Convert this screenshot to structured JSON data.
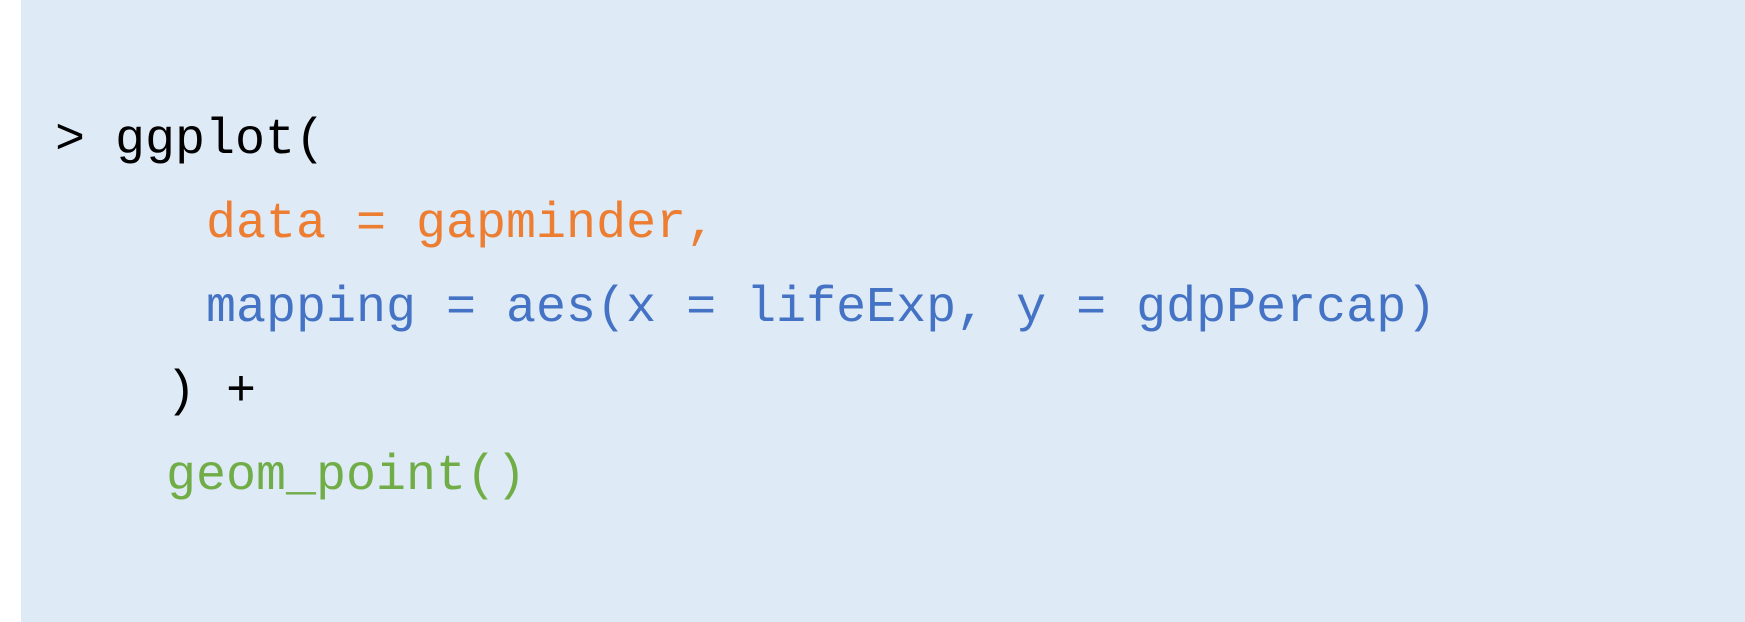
{
  "colors": {
    "background": "#deeaf6",
    "default_text": "#000000",
    "data_arg": "#ed7d31",
    "mapping_arg": "#4472c4",
    "geom": "#70ad47"
  },
  "code": {
    "lines": [
      {
        "text": "> ggplot("
      },
      {
        "text": "data = gapminder,"
      },
      {
        "text": "mapping = aes(x = lifeExp, y = gdpPercap)"
      },
      {
        "text": ") +"
      },
      {
        "text": "geom_point()"
      }
    ]
  }
}
